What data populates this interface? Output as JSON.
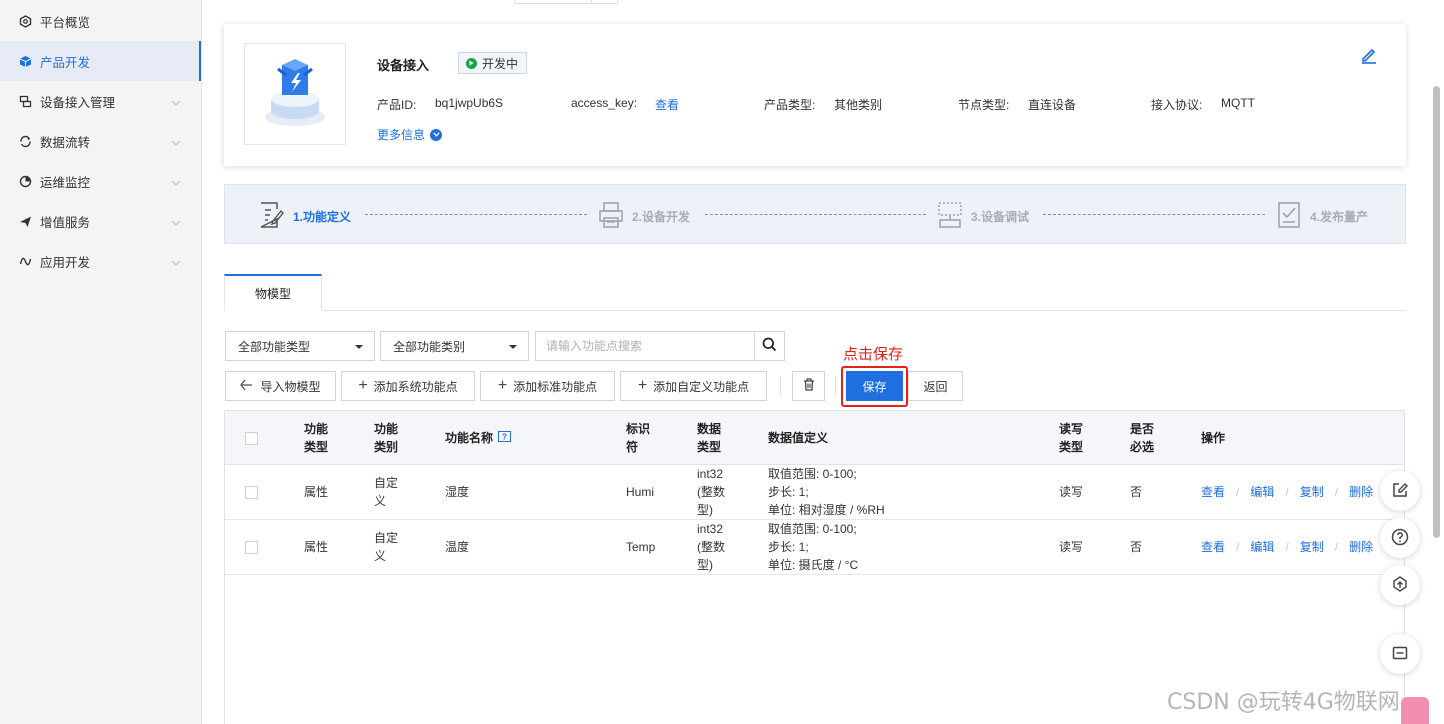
{
  "sidebar": {
    "items": [
      {
        "label": "平台概览",
        "icon": "hexagon-icon",
        "active": false,
        "chevron": false
      },
      {
        "label": "产品开发",
        "icon": "cube-icon",
        "active": true,
        "chevron": false
      },
      {
        "label": "设备接入管理",
        "icon": "device-icon",
        "active": false,
        "chevron": true
      },
      {
        "label": "数据流转",
        "icon": "flow-icon",
        "active": false,
        "chevron": true
      },
      {
        "label": "运维监控",
        "icon": "monitor-icon",
        "active": false,
        "chevron": true
      },
      {
        "label": "增值服务",
        "icon": "plane-icon",
        "active": false,
        "chevron": true
      },
      {
        "label": "应用开发",
        "icon": "app-dev-icon",
        "active": false,
        "chevron": true
      }
    ]
  },
  "product": {
    "name": "设备接入",
    "status": "开发中",
    "id_label": "产品ID:",
    "id_value": "bq1jwpUb6S",
    "access_key_label": "access_key:",
    "access_key_link": "查看",
    "type_label": "产品类型:",
    "type_value": "其他类别",
    "node_label": "节点类型:",
    "node_value": "直连设备",
    "protocol_label": "接入协议:",
    "protocol_value": "MQTT",
    "more_info": "更多信息"
  },
  "steps": [
    {
      "label": "1.功能定义",
      "active": true
    },
    {
      "label": "2.设备开发",
      "active": false
    },
    {
      "label": "3.设备调试",
      "active": false
    },
    {
      "label": "4.发布量产",
      "active": false
    }
  ],
  "tabs": [
    {
      "label": "物模型",
      "active": true
    }
  ],
  "filters": {
    "type_select": "全部功能类型",
    "category_select": "全部功能类别",
    "search_placeholder": "请输入功能点搜索"
  },
  "annotation": "点击保存",
  "toolbar": {
    "import": "导入物模型",
    "add_system": "添加系统功能点",
    "add_standard": "添加标准功能点",
    "add_custom": "添加自定义功能点",
    "save": "保存",
    "back": "返回"
  },
  "table": {
    "headers": {
      "func_type": [
        "功能",
        "类型"
      ],
      "func_category": [
        "功能",
        "类别"
      ],
      "func_name": "功能名称",
      "identifier": [
        "标识",
        "符"
      ],
      "data_type": [
        "数据",
        "类型"
      ],
      "data_def": "数据值定义",
      "rw": [
        "读写",
        "类型"
      ],
      "required": [
        "是否",
        "必选"
      ],
      "ops": "操作"
    },
    "rows": [
      {
        "func_type": "属性",
        "func_category": [
          "自定",
          "义"
        ],
        "name": "湿度",
        "identifier": "Humi",
        "data_type": [
          "int32",
          "(整数",
          "型)"
        ],
        "def": [
          "取值范围: 0-100;",
          "步长: 1;",
          "单位: 相对湿度 / %RH"
        ],
        "rw": "读写",
        "required": "否"
      },
      {
        "func_type": "属性",
        "func_category": [
          "自定",
          "义"
        ],
        "name": "温度",
        "identifier": "Temp",
        "data_type": [
          "int32",
          "(整数",
          "型)"
        ],
        "def": [
          "取值范围: 0-100;",
          "步长: 1;",
          "单位: 摄氏度 / °C"
        ],
        "rw": "读写",
        "required": "否"
      }
    ],
    "ops": [
      "查看",
      "编辑",
      "复制",
      "删除"
    ]
  },
  "watermark": "CSDN @玩转4G物联网",
  "colors": {
    "primary": "#1f6fe0",
    "highlight": "#e5211d",
    "status_green": "#19a34a"
  }
}
